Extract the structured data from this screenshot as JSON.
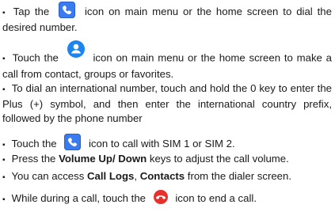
{
  "colors": {
    "phone_icon_bg": "#3a7cf0",
    "contact_icon_bg": "#1e84f0",
    "end_call_icon_bg": "#e6322e"
  },
  "icons": [
    "phone-icon",
    "contacts-icon",
    "end-call-icon"
  ],
  "bullet": "▪",
  "p1": {
    "before": "Tap the",
    "after": "icon on main menu or the home screen to dial the desired number."
  },
  "p2": {
    "before": "Touch the",
    "after": "icon on main menu or the home screen to make a call from contact, groups or favorites."
  },
  "p3": {
    "text": "To dial an international number, touch and hold the 0 key to enter the Plus (+) symbol, and then enter the international country prefix, followed by the phone number"
  },
  "p4": {
    "before": "Touch the",
    "after": "icon to call with SIM 1 or SIM 2."
  },
  "p5": {
    "pre": "Press the",
    "bold": "Volume Up/ Down",
    "post": "keys to adjust the call volume."
  },
  "p6": {
    "pre": "You can access",
    "bold1": "Call Logs",
    "sep": ",",
    "bold2": "Contacts",
    "post": "from the dialer screen."
  },
  "p7": {
    "before": "While during a call, touch the",
    "after": "icon to end a call."
  }
}
